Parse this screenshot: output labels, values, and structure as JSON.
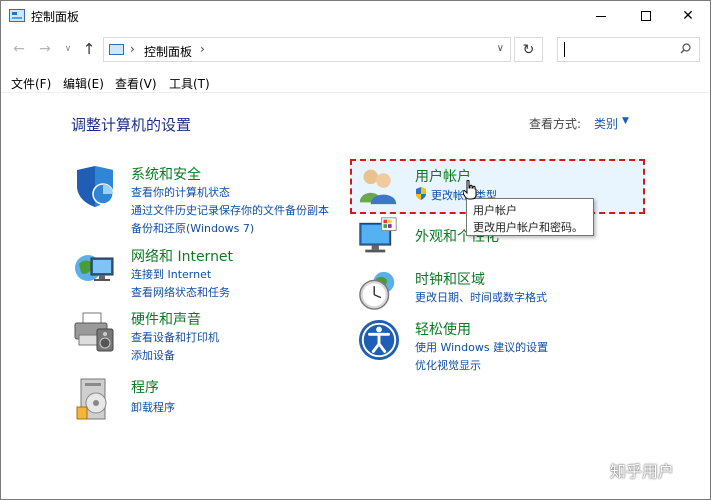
{
  "window": {
    "title": "控制面板",
    "controls": {
      "minimize": "–",
      "maximize": "□",
      "close": "✕"
    }
  },
  "nav": {
    "back": "←",
    "forward": "→",
    "dropdown": "∨",
    "up": "↑",
    "address_sep1": "›",
    "address_path": "控制面板",
    "address_sep2": "›",
    "address_dropdown": "∨",
    "refresh": "↻",
    "search_placeholder": ""
  },
  "menubar": {
    "file": "文件(F)",
    "edit": "编辑(E)",
    "view": "查看(V)",
    "tools": "工具(T)"
  },
  "main": {
    "heading": "调整计算机的设置",
    "view_by_label": "查看方式:",
    "view_by_value": "类别",
    "view_by_arrow": "▼"
  },
  "categories": {
    "system": {
      "title": "系统和安全",
      "links": [
        "查看你的计算机状态",
        "通过文件历史记录保存你的文件备份副本",
        "备份和还原(Windows 7)"
      ]
    },
    "network": {
      "title": "网络和 Internet",
      "links": [
        "连接到 Internet",
        "查看网络状态和任务"
      ]
    },
    "hardware": {
      "title": "硬件和声音",
      "links": [
        "查看设备和打印机",
        "添加设备"
      ]
    },
    "programs": {
      "title": "程序",
      "links": [
        "卸载程序"
      ]
    },
    "accounts": {
      "title": "用户帐户",
      "links": [
        "更改帐户类型"
      ]
    },
    "appearance": {
      "title": "外观和个性化",
      "links": []
    },
    "clock": {
      "title": "时钟和区域",
      "links": [
        "更改日期、时间或数字格式"
      ]
    },
    "ease": {
      "title": "轻松使用",
      "links": [
        "使用 Windows 建议的设置",
        "优化视觉显示"
      ]
    }
  },
  "tooltip": {
    "line1": "用户帐户",
    "line2": "更改用户帐户和密码。"
  },
  "watermark": "知乎用户",
  "colors": {
    "category_title": "#0c7a24",
    "link": "#0f4fa6",
    "heading": "#1e3287",
    "highlight_bg": "#e8f4fe",
    "highlight_border": "#d11a1a"
  }
}
